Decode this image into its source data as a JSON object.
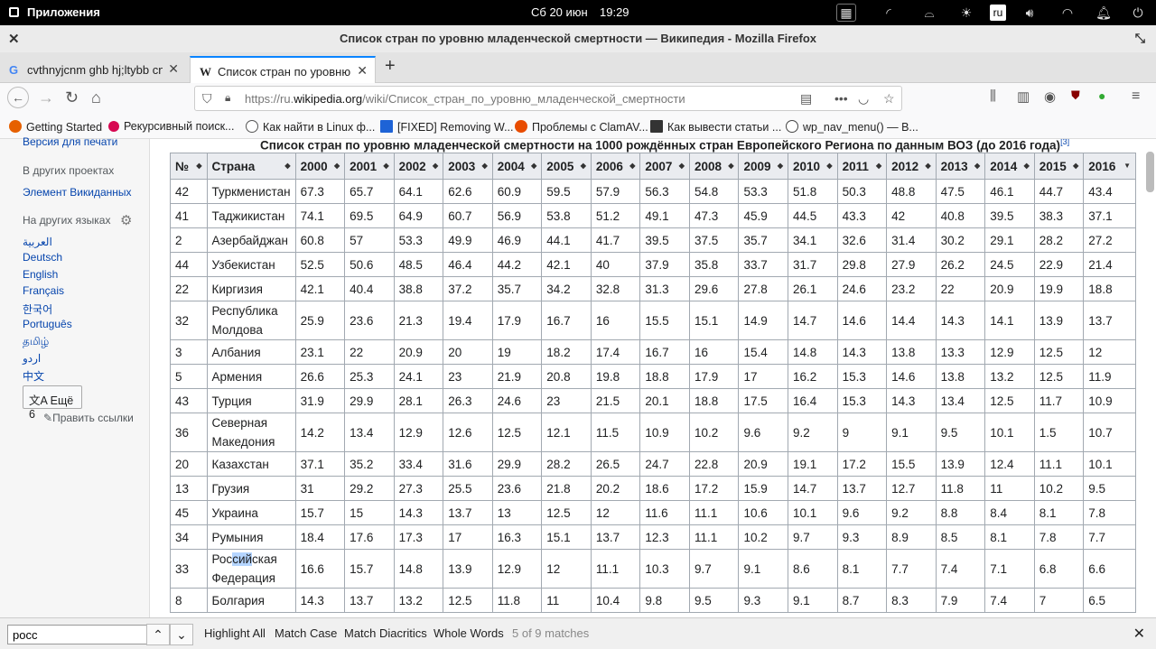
{
  "system": {
    "apps_label": "Приложения",
    "date": "Сб 20 июн",
    "time": "19:29",
    "lang": "ru"
  },
  "window": {
    "title": "Список стран по уровню младенческой смертности — Википедия - Mozilla Firefox"
  },
  "tabs": [
    {
      "favicon": "G",
      "label": "cvthnyjcnm ghb hj;ltybb cnfnb"
    },
    {
      "favicon": "W",
      "label": "Список стран по уровню мл"
    }
  ],
  "url": {
    "prefix": "https://ru.",
    "domain": "wikipedia.org",
    "path": "/wiki/Список_стран_по_уровню_младенческой_смертности"
  },
  "bookmarks": [
    {
      "label": "Getting Started",
      "color": "#e66000"
    },
    {
      "label": "Рекурсивный поиск...",
      "color": "#d70751"
    },
    {
      "label": "Как найти в Linux ф...",
      "color": "#555555"
    },
    {
      "label": "[FIXED] Removing W...",
      "color": "#1e63d6"
    },
    {
      "label": "Проблемы с ClamAV...",
      "color": "#e84c00"
    },
    {
      "label": "Как вывести статьи ...",
      "color": "#333333"
    },
    {
      "label": "wp_nav_menu() — В...",
      "color": "#444444"
    }
  ],
  "sidebar": {
    "print_version": "Версия для печати",
    "other_projects_head": "В других проектах",
    "wikidata": "Элемент Викиданных",
    "other_langs_head": "На других языках",
    "languages": [
      "العربية",
      "Deutsch",
      "English",
      "Français",
      "한국어",
      "Português",
      "தமிழ்",
      "اردو",
      "中文"
    ],
    "more_langs": "Ещё 6",
    "edit_links": "Править ссылки"
  },
  "content": {
    "caption": "Список стран по уровню младенческой смертности на 1000 рождённых стран Европейского Региона по данным ВОЗ (до 2016 года)",
    "caption_ref": "[3]",
    "columns": [
      "№",
      "Страна",
      "2000",
      "2001",
      "2002",
      "2003",
      "2004",
      "2005",
      "2006",
      "2007",
      "2008",
      "2009",
      "2010",
      "2011",
      "2012",
      "2013",
      "2014",
      "2015",
      "2016"
    ],
    "rows": [
      {
        "n": "42",
        "country": "Туркменистан",
        "vals": [
          "67.3",
          "65.7",
          "64.1",
          "62.6",
          "60.9",
          "59.5",
          "57.9",
          "56.3",
          "54.8",
          "53.3",
          "51.8",
          "50.3",
          "48.8",
          "47.5",
          "46.1",
          "44.7",
          "43.4"
        ]
      },
      {
        "n": "41",
        "country": "Таджикистан",
        "vals": [
          "74.1",
          "69.5",
          "64.9",
          "60.7",
          "56.9",
          "53.8",
          "51.2",
          "49.1",
          "47.3",
          "45.9",
          "44.5",
          "43.3",
          "42",
          "40.8",
          "39.5",
          "38.3",
          "37.1"
        ]
      },
      {
        "n": "2",
        "country": "Азербайджан",
        "vals": [
          "60.8",
          "57",
          "53.3",
          "49.9",
          "46.9",
          "44.1",
          "41.7",
          "39.5",
          "37.5",
          "35.7",
          "34.1",
          "32.6",
          "31.4",
          "30.2",
          "29.1",
          "28.2",
          "27.2"
        ]
      },
      {
        "n": "44",
        "country": "Узбекистан",
        "vals": [
          "52.5",
          "50.6",
          "48.5",
          "46.4",
          "44.2",
          "42.1",
          "40",
          "37.9",
          "35.8",
          "33.7",
          "31.7",
          "29.8",
          "27.9",
          "26.2",
          "24.5",
          "22.9",
          "21.4"
        ]
      },
      {
        "n": "22",
        "country": "Киргизия",
        "vals": [
          "42.1",
          "40.4",
          "38.8",
          "37.2",
          "35.7",
          "34.2",
          "32.8",
          "31.3",
          "29.6",
          "27.8",
          "26.1",
          "24.6",
          "23.2",
          "22",
          "20.9",
          "19.9",
          "18.8"
        ]
      },
      {
        "n": "32",
        "country": "Республика Молдова",
        "vals": [
          "25.9",
          "23.6",
          "21.3",
          "19.4",
          "17.9",
          "16.7",
          "16",
          "15.5",
          "15.1",
          "14.9",
          "14.7",
          "14.6",
          "14.4",
          "14.3",
          "14.1",
          "13.9",
          "13.7"
        ]
      },
      {
        "n": "3",
        "country": "Албания",
        "vals": [
          "23.1",
          "22",
          "20.9",
          "20",
          "19",
          "18.2",
          "17.4",
          "16.7",
          "16",
          "15.4",
          "14.8",
          "14.3",
          "13.8",
          "13.3",
          "12.9",
          "12.5",
          "12"
        ]
      },
      {
        "n": "5",
        "country": "Армения",
        "vals": [
          "26.6",
          "25.3",
          "24.1",
          "23",
          "21.9",
          "20.8",
          "19.8",
          "18.8",
          "17.9",
          "17",
          "16.2",
          "15.3",
          "14.6",
          "13.8",
          "13.2",
          "12.5",
          "11.9"
        ]
      },
      {
        "n": "43",
        "country": "Турция",
        "vals": [
          "31.9",
          "29.9",
          "28.1",
          "26.3",
          "24.6",
          "23",
          "21.5",
          "20.1",
          "18.8",
          "17.5",
          "16.4",
          "15.3",
          "14.3",
          "13.4",
          "12.5",
          "11.7",
          "10.9"
        ]
      },
      {
        "n": "36",
        "country": "Северная Македония",
        "vals": [
          "14.2",
          "13.4",
          "12.9",
          "12.6",
          "12.5",
          "12.1",
          "11.5",
          "10.9",
          "10.2",
          "9.6",
          "9.2",
          "9",
          "9.1",
          "9.5",
          "10.1",
          "1.5",
          "10.7"
        ]
      },
      {
        "n": "20",
        "country": "Казахстан",
        "vals": [
          "37.1",
          "35.2",
          "33.4",
          "31.6",
          "29.9",
          "28.2",
          "26.5",
          "24.7",
          "22.8",
          "20.9",
          "19.1",
          "17.2",
          "15.5",
          "13.9",
          "12.4",
          "11.1",
          "10.1"
        ]
      },
      {
        "n": "13",
        "country": "Грузия",
        "vals": [
          "31",
          "29.2",
          "27.3",
          "25.5",
          "23.6",
          "21.8",
          "20.2",
          "18.6",
          "17.2",
          "15.9",
          "14.7",
          "13.7",
          "12.7",
          "11.8",
          "11",
          "10.2",
          "9.5"
        ]
      },
      {
        "n": "45",
        "country": "Украина",
        "vals": [
          "15.7",
          "15",
          "14.3",
          "13.7",
          "13",
          "12.5",
          "12",
          "11.6",
          "11.1",
          "10.6",
          "10.1",
          "9.6",
          "9.2",
          "8.8",
          "8.4",
          "8.1",
          "7.8"
        ]
      },
      {
        "n": "34",
        "country": "Румыния",
        "vals": [
          "18.4",
          "17.6",
          "17.3",
          "17",
          "16.3",
          "15.1",
          "13.7",
          "12.3",
          "11.1",
          "10.2",
          "9.7",
          "9.3",
          "8.9",
          "8.5",
          "8.1",
          "7.8",
          "7.7"
        ]
      },
      {
        "n": "33",
        "country": "Российская Федерация",
        "hl": [
          "Рос",
          "сий",
          "ская Федерация"
        ],
        "vals": [
          "16.6",
          "15.7",
          "14.8",
          "13.9",
          "12.9",
          "12",
          "11.1",
          "10.3",
          "9.7",
          "9.1",
          "8.6",
          "8.1",
          "7.7",
          "7.4",
          "7.1",
          "6.8",
          "6.6"
        ]
      },
      {
        "n": "8",
        "country": "Болгария",
        "vals": [
          "14.3",
          "13.7",
          "13.2",
          "12.5",
          "11.8",
          "11",
          "10.4",
          "9.8",
          "9.5",
          "9.3",
          "9.1",
          "8.7",
          "8.3",
          "7.9",
          "7.4",
          "7",
          "6.5"
        ]
      }
    ]
  },
  "findbar": {
    "query": "росс",
    "highlight_all": "Highlight All",
    "match_case": "Match Case",
    "match_diacritics": "Match Diacritics",
    "whole_words": "Whole Words",
    "status": "5 of 9 matches"
  }
}
